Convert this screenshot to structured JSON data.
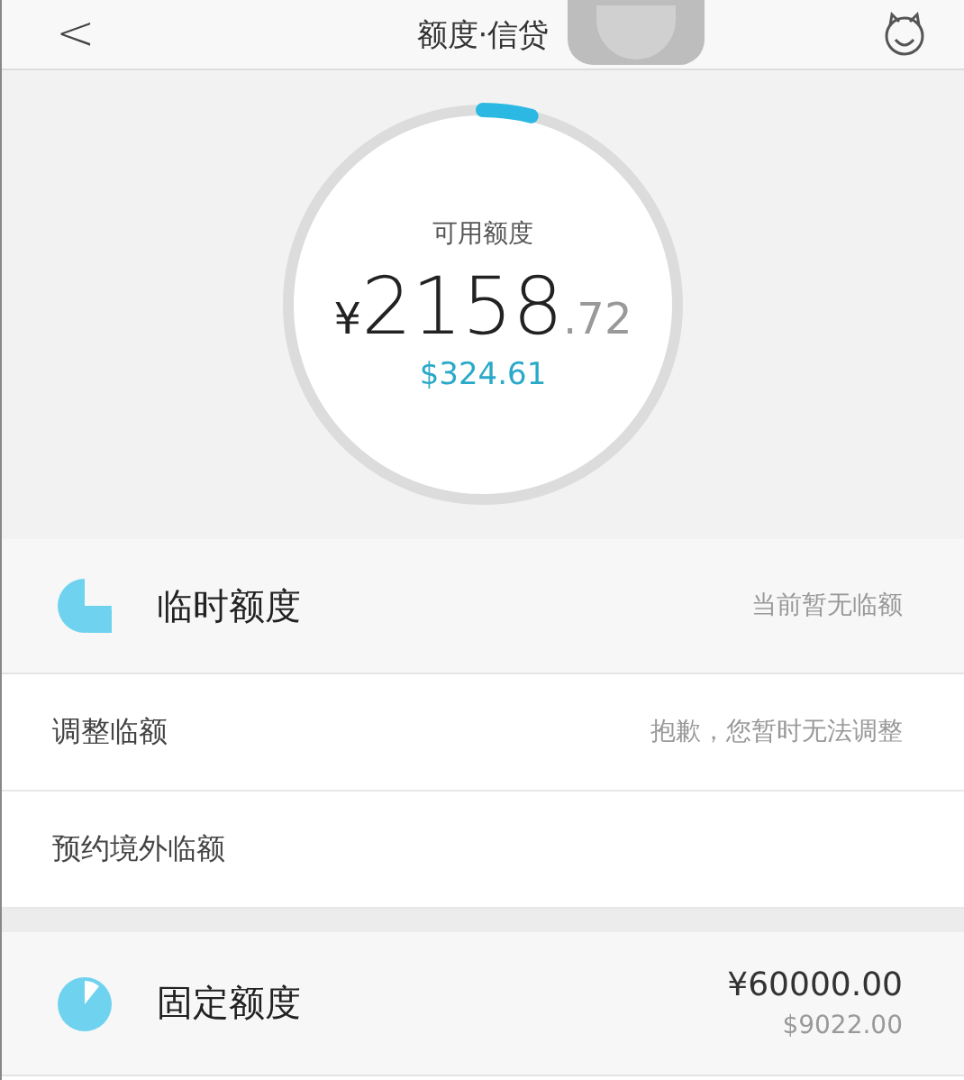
{
  "nav": {
    "back": "<",
    "title": "额度·信贷"
  },
  "gauge": {
    "label": "可用额度",
    "currency": "¥",
    "integer": "2158",
    "decimal": ".72",
    "secondary": "$324.61",
    "level": 0.04
  },
  "temporary": {
    "title": "临时额度",
    "status": "当前暂无临额",
    "rows": [
      {
        "label": "调整临额",
        "value": "抱歉，您暂时无法调整"
      },
      {
        "label": "预约境外临额"
      }
    ]
  },
  "fixed": {
    "title": "固定额度",
    "amount": "¥60000.00",
    "secondary": "$9022.00"
  }
}
